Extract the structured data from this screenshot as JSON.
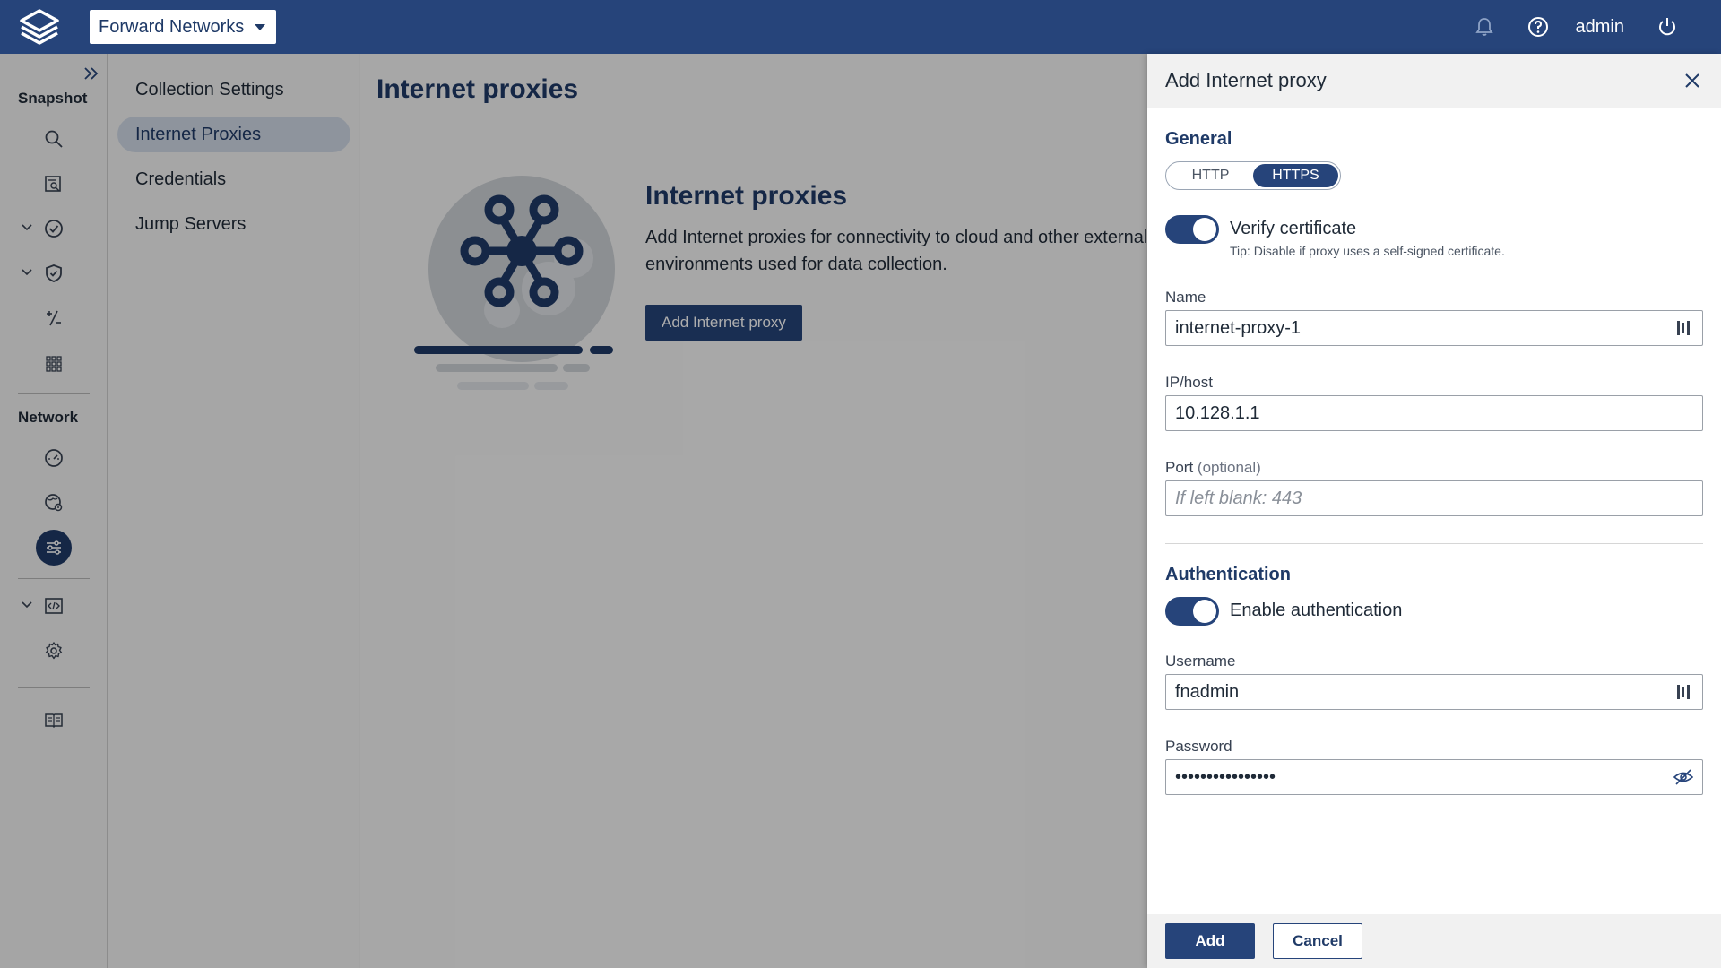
{
  "topbar": {
    "org_name": "Forward Networks",
    "user": "admin",
    "icons": [
      "bell-icon",
      "help-icon",
      "power-icon"
    ]
  },
  "rail": {
    "snapshot_label": "Snapshot",
    "network_label": "Network"
  },
  "subnav": {
    "items": [
      {
        "label": "Collection Settings",
        "active": false
      },
      {
        "label": "Internet Proxies",
        "active": true
      },
      {
        "label": "Credentials",
        "active": false
      },
      {
        "label": "Jump Servers",
        "active": false
      }
    ]
  },
  "main": {
    "page_title": "Internet proxies",
    "empty_title": "Internet proxies",
    "empty_desc": "Add Internet proxies for connectivity to cloud and other external environments used for data collection.",
    "add_button": "Add Internet proxy"
  },
  "drawer": {
    "title": "Add Internet proxy",
    "general_title": "General",
    "protocol_options": [
      "HTTP",
      "HTTPS"
    ],
    "protocol_selected": "HTTPS",
    "verify_label": "Verify certificate",
    "verify_tip": "Tip: Disable if proxy uses a self-signed certificate.",
    "name_label": "Name",
    "name_value": "internet-proxy-1",
    "host_label": "IP/host",
    "host_value": "10.128.1.1",
    "port_label": "Port",
    "port_optional": "(optional)",
    "port_placeholder": "If left blank: 443",
    "auth_title": "Authentication",
    "auth_label": "Enable authentication",
    "username_label": "Username",
    "username_value": "fnadmin",
    "password_label": "Password",
    "password_value": "••••••••••••••••",
    "add_label": "Add",
    "cancel_label": "Cancel"
  },
  "colors": {
    "brand": "#26447a",
    "accent_text": "#1f3a67",
    "active_nav": "#d2dbe8"
  }
}
